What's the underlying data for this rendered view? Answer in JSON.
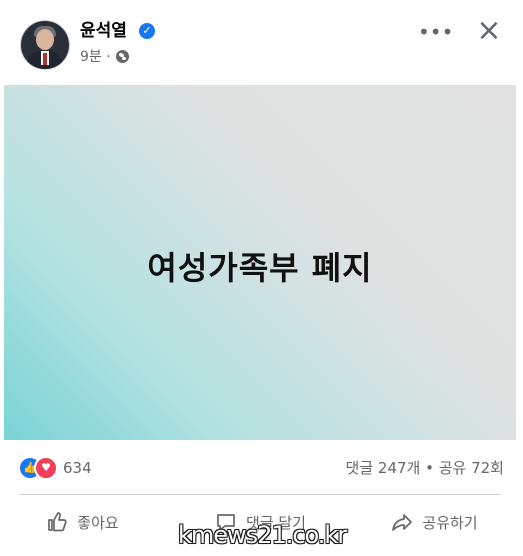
{
  "post": {
    "author": "윤석열",
    "time": "9분",
    "separator": "·",
    "headline": "여성가족부 폐지"
  },
  "stats": {
    "reactions_count": "634",
    "comments_shares": "댓글 247개 • 공유 72회"
  },
  "actions": {
    "like": "좋아요",
    "comment": "댓글 달기",
    "share": "공유하기"
  },
  "icons": {
    "verified": "verified-badge-icon",
    "privacy": "globe-icon",
    "more": "more-icon",
    "close": "close-icon",
    "like_reaction": "like-reaction-icon",
    "love_reaction": "love-reaction-icon"
  },
  "watermark": "kmews21.co.kr",
  "colors": {
    "accent": "#1877f2",
    "love": "#f33e58",
    "secondary_text": "#65676b"
  }
}
